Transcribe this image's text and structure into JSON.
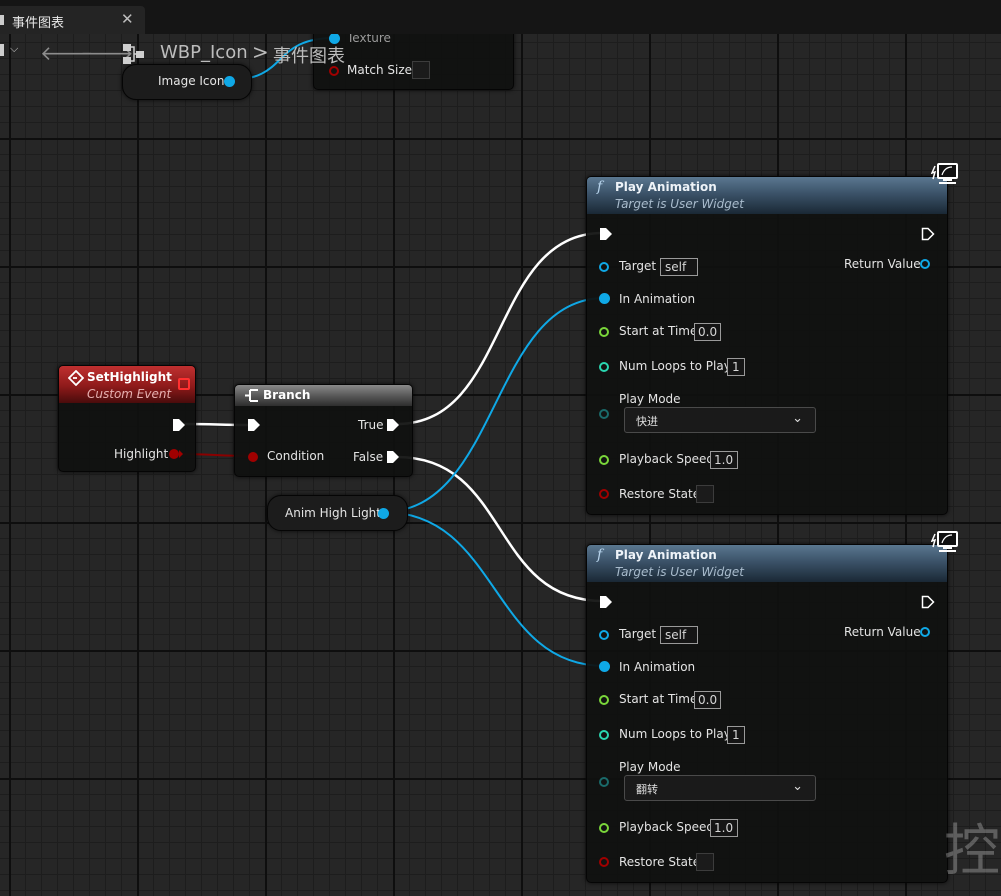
{
  "tab": {
    "title": "事件图表",
    "close_glyph": "✕"
  },
  "nav": {
    "back": "🡐",
    "forward": "🡒",
    "crumb_root": "WBP_Icon",
    "separator": ">",
    "crumb_current": "事件图表"
  },
  "top_node": {
    "texture_label": "Texture",
    "match_size_label": "Match Size"
  },
  "image_icon_node": {
    "label": "Image Icon"
  },
  "event_node": {
    "title": "SetHighlight",
    "subtitle": "Custom Event",
    "pin_label": "Highlight"
  },
  "branch_node": {
    "title": "Branch",
    "condition_label": "Condition",
    "true_label": "True",
    "false_label": "False"
  },
  "anim_var_node": {
    "label": "Anim High Light"
  },
  "play_nodes": [
    {
      "title": "Play Animation",
      "subtitle": "Target is User Widget",
      "target_label": "Target",
      "target_value": "self",
      "return_label": "Return Value",
      "in_anim_label": "In Animation",
      "start_label": "Start at Time",
      "start_value": "0.0",
      "loops_label": "Num Loops to Play",
      "loops_value": "1",
      "mode_label": "Play Mode",
      "mode_value": "快进",
      "speed_label": "Playback Speed",
      "speed_value": "1.0",
      "restore_label": "Restore State"
    },
    {
      "title": "Play Animation",
      "subtitle": "Target is User Widget",
      "target_label": "Target",
      "target_value": "self",
      "return_label": "Return Value",
      "in_anim_label": "In Animation",
      "start_label": "Start at Time",
      "start_value": "0.0",
      "loops_label": "Num Loops to Play",
      "loops_value": "1",
      "mode_label": "Play Mode",
      "mode_value": "翻转",
      "speed_label": "Playback Speed",
      "speed_value": "1.0",
      "restore_label": "Restore State"
    }
  ],
  "watermark": "控",
  "colors": {
    "object_pin": "#0fa8e6",
    "exec_pin": "#ffffff",
    "float_pin": "#7ad63a",
    "int_pin": "#2ad6b0",
    "bool_pin": "#a00000",
    "byte_pin": "#1a6a6a",
    "event_header": "#9b1c1c",
    "function_header": "#3b5268"
  }
}
